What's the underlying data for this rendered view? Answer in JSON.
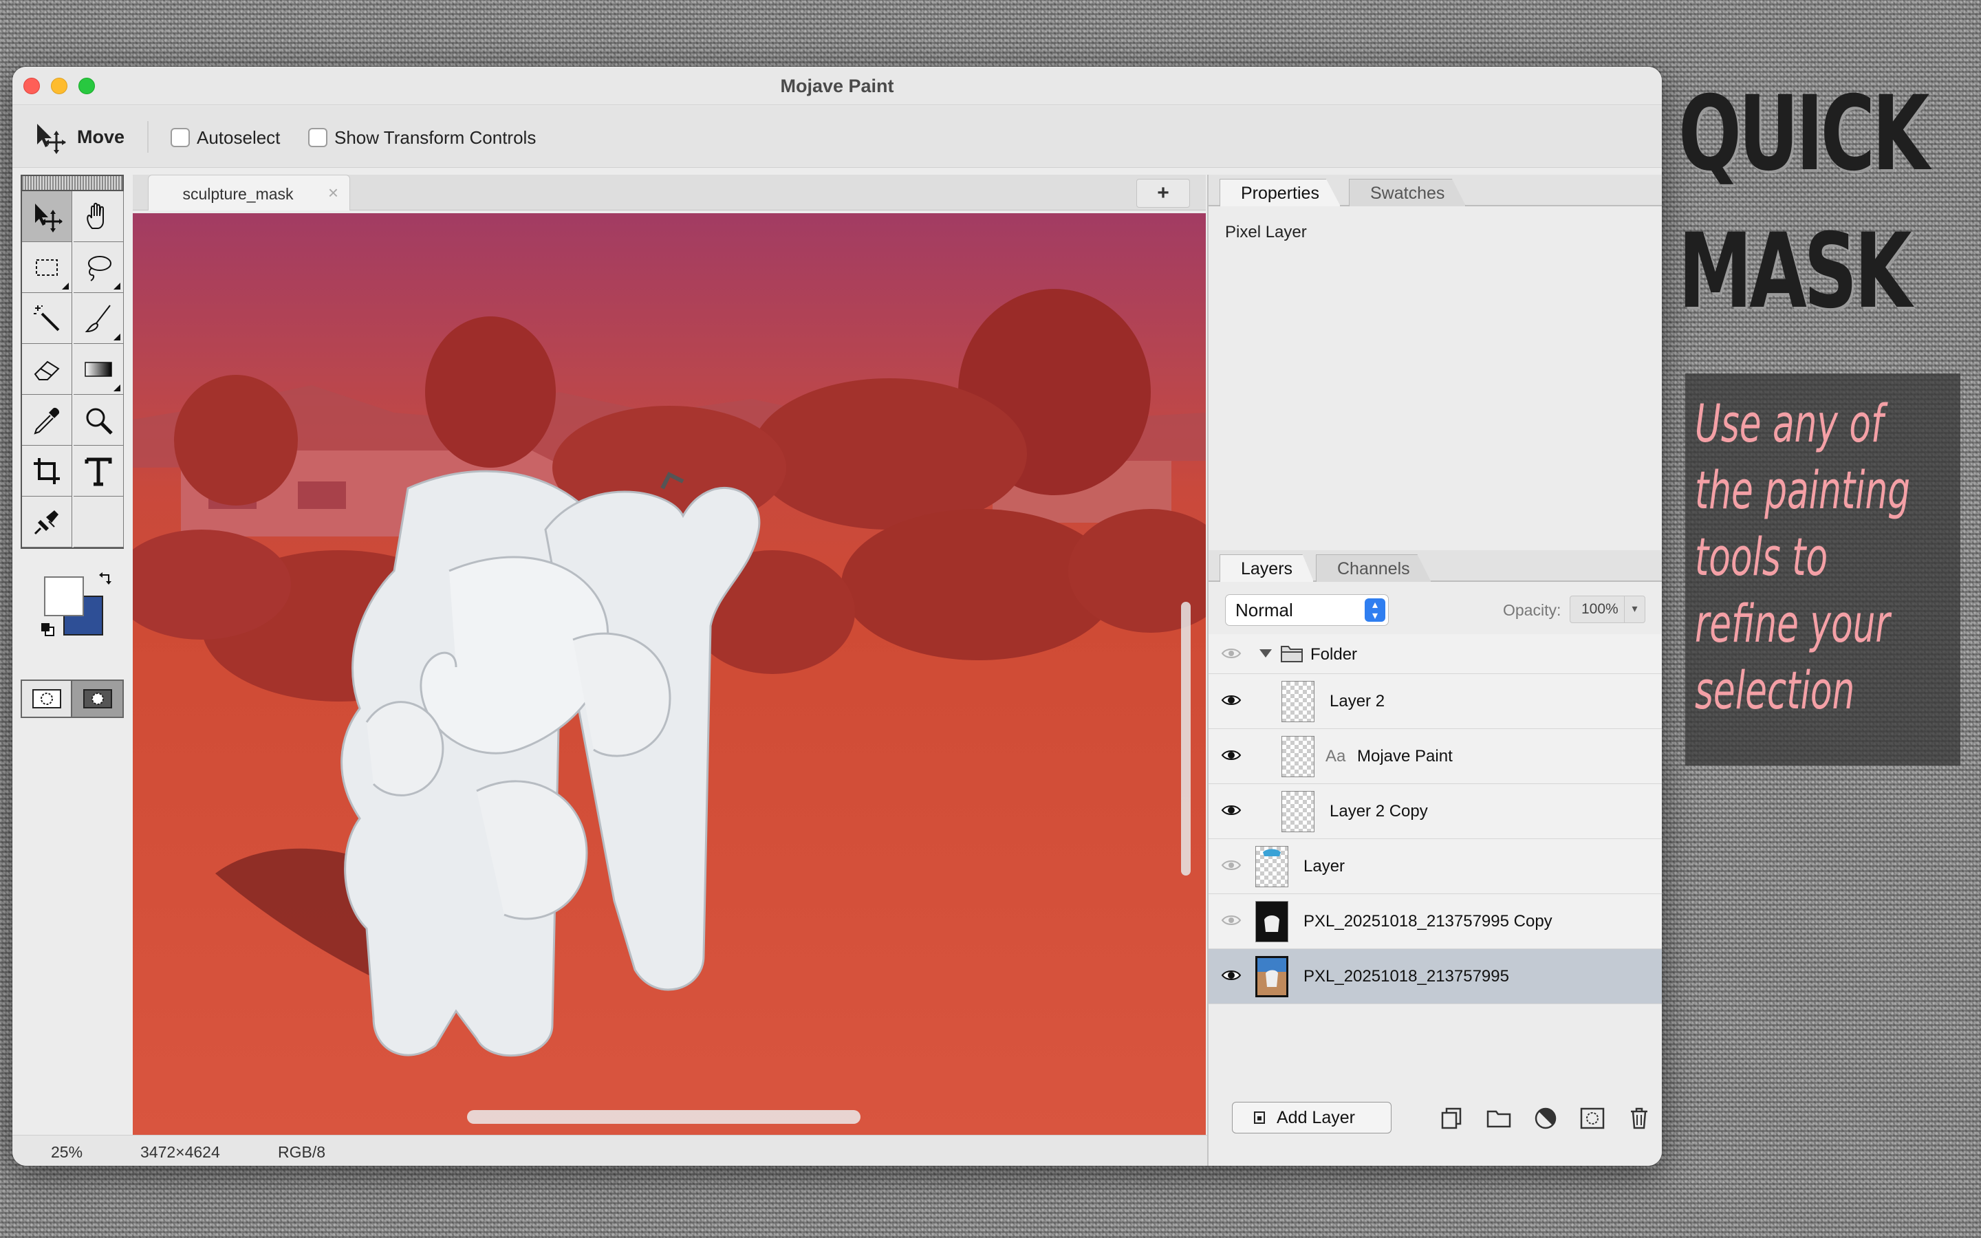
{
  "window": {
    "title": "Mojave Paint"
  },
  "toolbar": {
    "tool_name": "Move",
    "autoselect_label": "Autoselect",
    "autoselect_checked": false,
    "transform_label": "Show Transform Controls",
    "transform_checked": false
  },
  "tools": [
    {
      "name": "move-tool",
      "icon": "move-icon",
      "active": true
    },
    {
      "name": "hand-tool",
      "icon": "hand-icon"
    },
    {
      "name": "rect-select-tool",
      "icon": "marquee-icon",
      "submenu": true
    },
    {
      "name": "lasso-tool",
      "icon": "lasso-icon",
      "submenu": true
    },
    {
      "name": "magic-wand-tool",
      "icon": "magic-wand-icon"
    },
    {
      "name": "brush-tool",
      "icon": "brush-icon",
      "submenu": true
    },
    {
      "name": "eraser-tool",
      "icon": "eraser-icon"
    },
    {
      "name": "gradient-tool",
      "icon": "gradient-icon",
      "submenu": true
    },
    {
      "name": "eyedropper-tool",
      "icon": "eyedropper-icon"
    },
    {
      "name": "zoom-tool",
      "icon": "magnifier-icon"
    },
    {
      "name": "crop-tool",
      "icon": "crop-icon"
    },
    {
      "name": "text-tool",
      "icon": "text-icon"
    },
    {
      "name": "clone-tool",
      "icon": "clone-stamp-icon"
    }
  ],
  "colors": {
    "foreground": "#ffffff",
    "background": "#2e4f96",
    "mask_overlay": "#e0403a"
  },
  "document": {
    "tab_name": "sculpture_mask",
    "new_tab_label": "+"
  },
  "status": {
    "zoom": "25%",
    "dimensions": "3472×4624",
    "mode": "RGB/8"
  },
  "panels": {
    "top_tabs": [
      "Properties",
      "Swatches"
    ],
    "properties_type": "Pixel Layer",
    "bottom_tabs": [
      "Layers",
      "Channels"
    ]
  },
  "layers_panel": {
    "blend_mode": "Normal",
    "opacity_label": "Opacity:",
    "opacity_value": "100%",
    "layers": [
      {
        "name": "Folder",
        "type": "folder",
        "visible": false,
        "indent": 0
      },
      {
        "name": "Layer 2",
        "type": "pixel",
        "visible": true,
        "indent": 1
      },
      {
        "name": "Mojave Paint",
        "type": "text",
        "marker": "Aa",
        "visible": true,
        "indent": 1
      },
      {
        "name": "Layer 2 Copy",
        "type": "pixel",
        "visible": true,
        "indent": 1
      },
      {
        "name": "Layer",
        "type": "pixel",
        "visible": false,
        "indent": 0
      },
      {
        "name": "PXL_20251018_213757995 Copy",
        "type": "photo",
        "visible": false,
        "indent": 0
      },
      {
        "name": "PXL_20251018_213757995",
        "type": "photo",
        "visible": true,
        "indent": 0,
        "selected": true
      }
    ],
    "add_layer_label": "Add Layer"
  },
  "promo": {
    "title_line1": "QUICK",
    "title_line2": "MASK",
    "subtitle_lines": [
      "Use any of",
      "the painting",
      "tools to",
      "refine your",
      "selection"
    ]
  }
}
